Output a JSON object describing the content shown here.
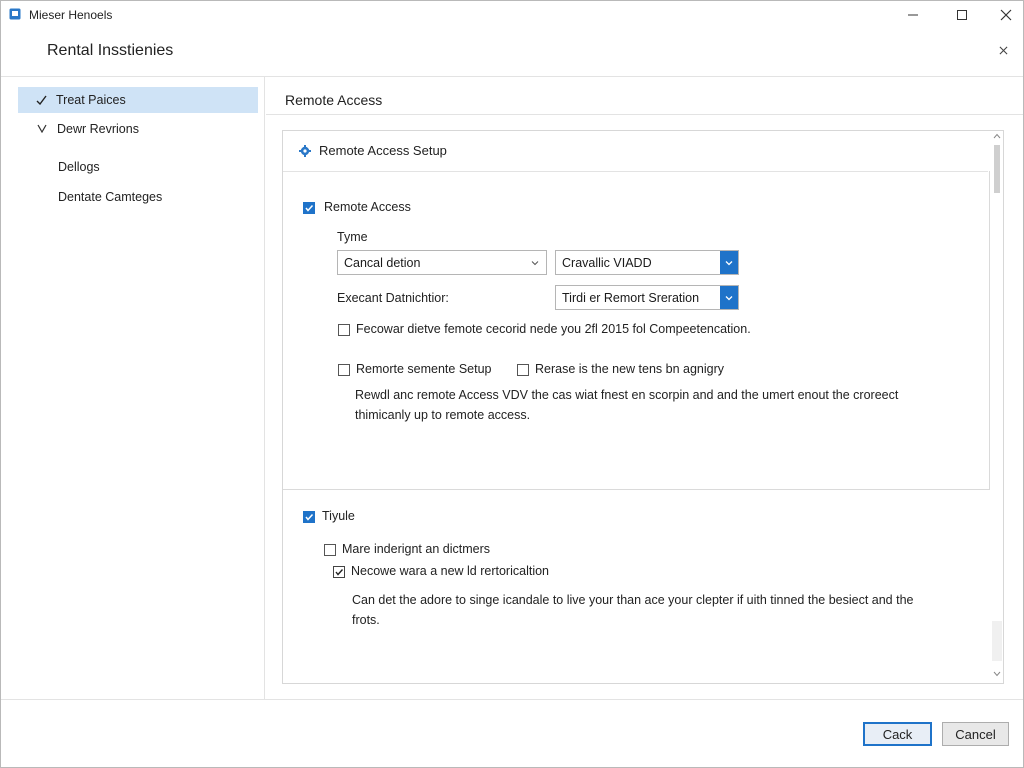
{
  "window": {
    "title": "Mieser Henoels",
    "app_icon": "app-window-icon",
    "controls": [
      "minimize-icon",
      "maximize-icon",
      "close-icon"
    ]
  },
  "dialog": {
    "title": "Rental Insstienies",
    "close_icon": "close-icon"
  },
  "sidebar": {
    "items": [
      {
        "label": "Treat Paices",
        "icon": "check-icon",
        "selected": true
      },
      {
        "label": "Dewr Revrions",
        "icon": "chevron-down-icon",
        "selected": false
      },
      {
        "label": "Dellogs",
        "selected": false
      },
      {
        "label": "Dentate Camteges",
        "selected": false
      }
    ]
  },
  "main": {
    "section_title": "Remote Access",
    "panel": {
      "title": "Remote Access Setup",
      "icon": "gear-icon",
      "remote_access": {
        "label": "Remote Access",
        "checked": true,
        "type_label": "Tyme",
        "type_combo_value": "Cancal detion",
        "second_combo_value": "Cravallic VIADD",
        "excerpt_label": "Execant Datnichtior:",
        "excerpt_combo_value": "Tirdi er Remort Sreration",
        "option1_label": "Fecowar dietve femote cecorid nede you 2fl 2015 fol Compeetencation.",
        "option1_checked": false,
        "option2_label": "Remorte semente Setup",
        "option2_checked": false,
        "option3_label": "Rerase is the new tens bn agnigry",
        "option3_checked": false,
        "description_line1": "Rewdl anc remote Access VDV the cas wiat fnest en scorpin and and the umert enout the croreect",
        "description_line2": "thimicanly up to remote access."
      },
      "second_section": {
        "label": "Tiyule",
        "checked": true,
        "option1_label": "Mare inderignt an dictmers",
        "option1_checked": false,
        "option2_label": "Necowe wara a new ld rertoricaltion",
        "option2_checked": true,
        "description_line1": "Can det the adore to singe icandale to live your than ace your clepter if uith tinned the besiect and the",
        "description_line2": "frots."
      }
    }
  },
  "footer": {
    "primary_button": "Cack",
    "cancel_button": "Cancel"
  },
  "colors": {
    "accent": "#1f73c9",
    "selected_row": "#cfe3f6",
    "border": "#d7d7d7"
  }
}
